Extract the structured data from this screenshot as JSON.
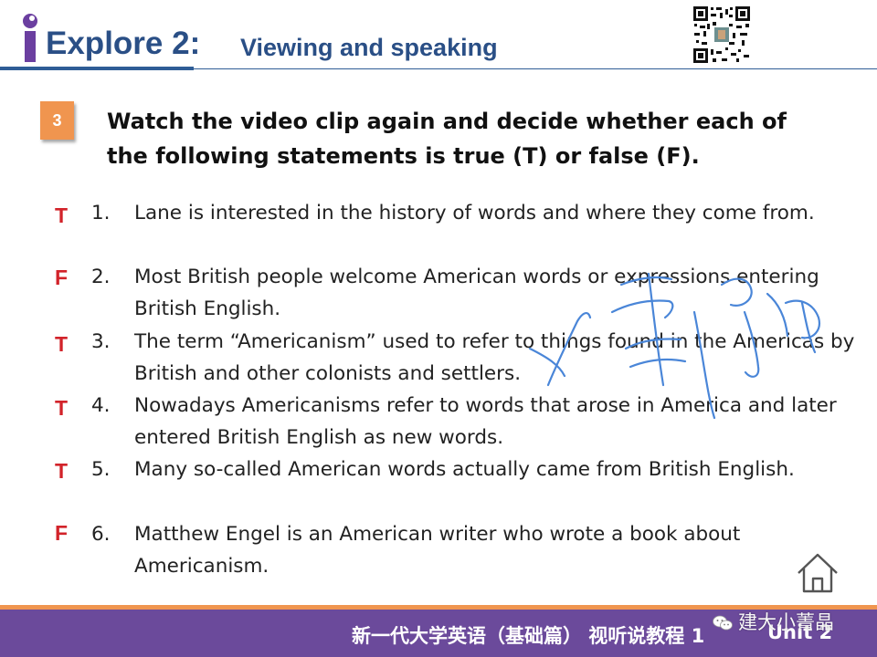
{
  "header": {
    "title_main": "Explore 2:",
    "title_sub": "Viewing and speaking",
    "logo_icon": "i-logo-icon",
    "qr_icon": "qr-code-icon"
  },
  "task": {
    "number": "3",
    "instruction_line1": "Watch the video clip again and decide whether each of",
    "instruction_line2": "the following statements is true (T) or false (F)."
  },
  "statements": [
    {
      "answer": "T",
      "number": "1.",
      "text": "Lane is interested in the history of words and where they come from."
    },
    {
      "answer": "F",
      "number": "2.",
      "text": "Most British people welcome American words or expressions entering British English."
    },
    {
      "answer": "T",
      "number": "3.",
      "text": "The term “Americanism” used to refer to things found in the Americas by British and other colonists and settlers."
    },
    {
      "answer": "T",
      "number": "4.",
      "text": "Nowadays Americanisms refer to words that arose in America and later entered British English as new words."
    },
    {
      "answer": "T",
      "number": "5.",
      "text": "Many so-called American words actually came from British English."
    },
    {
      "answer": "F",
      "number": "6.",
      "text": "Matthew Engel is an American writer who wrote a book about Americanism."
    }
  ],
  "footer": {
    "course_title": "新一代大学英语（基础篇） 视听说教程 1",
    "unit": "Unit 2",
    "watermark": "建大小菁晶",
    "home_icon": "home-icon"
  },
  "colors": {
    "title_blue": "#2a4f86",
    "answer_red": "#d2232a",
    "badge_orange": "#f0954f",
    "footer_purple": "#6b4a9b",
    "signature_blue": "#4a86d8"
  }
}
